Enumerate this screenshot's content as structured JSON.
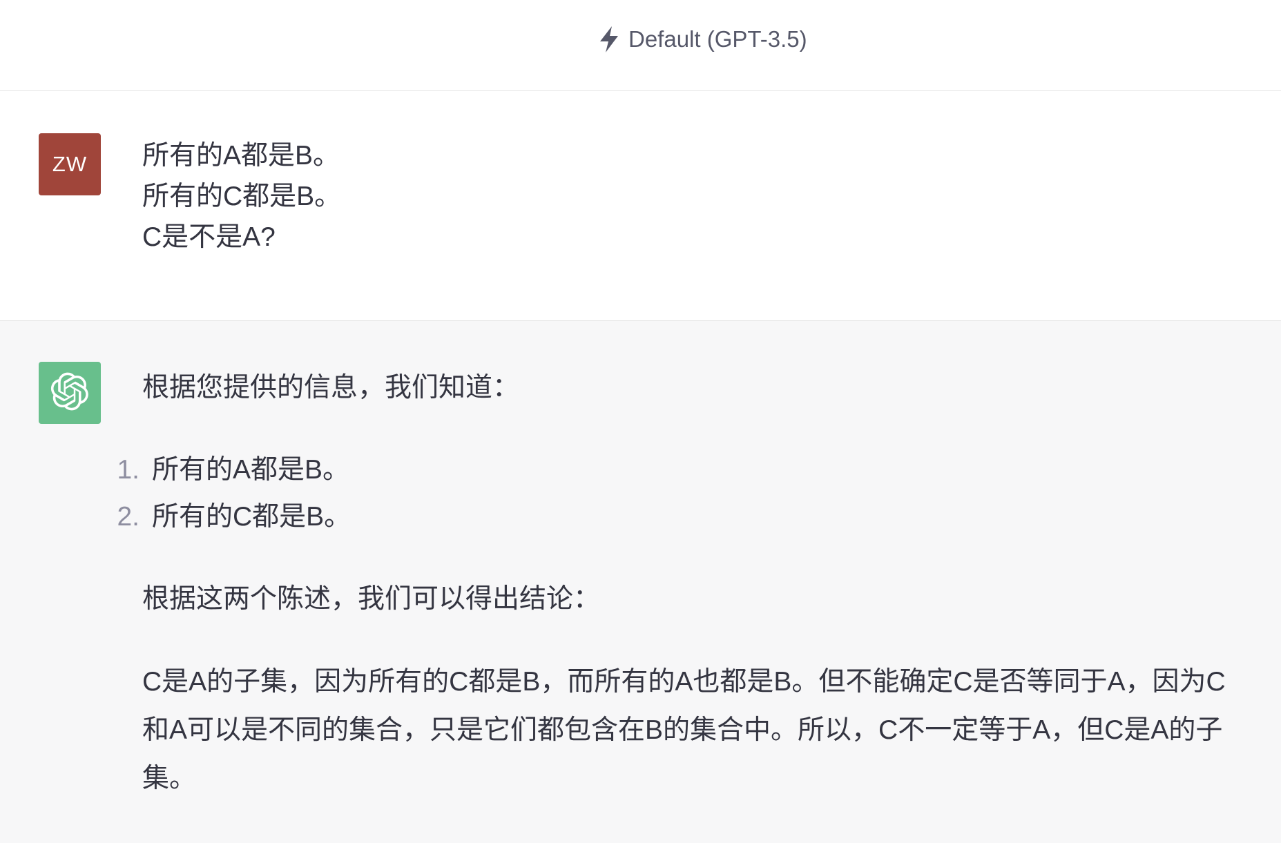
{
  "header": {
    "model_label": "Default (GPT-3.5)",
    "icon": "lightning-bolt-icon"
  },
  "user_message": {
    "avatar_initials": "ZW",
    "lines": [
      "所有的A都是B。",
      "所有的C都是B。",
      "C是不是A?"
    ]
  },
  "assistant_message": {
    "avatar_icon": "openai-logo-icon",
    "intro": "根据您提供的信息，我们知道：",
    "list": [
      {
        "number": "1.",
        "text": "所有的A都是B。"
      },
      {
        "number": "2.",
        "text": "所有的C都是B。"
      }
    ],
    "conclusion_intro": "根据这两个陈述，我们可以得出结论：",
    "conclusion": "C是A的子集，因为所有的C都是B，而所有的A也都是B。但不能确定C是否等同于A，因为C和A可以是不同的集合，只是它们都包含在B的集合中。所以，C不一定等于A，但C是A的子集。"
  },
  "colors": {
    "text": "#343541",
    "header_text": "#565869",
    "list_number": "#8e8ea0",
    "user_avatar": "#a0453a",
    "assistant_avatar": "#68bf8c",
    "assistant_background": "#f7f7f8",
    "divider": "#e5e5e5"
  }
}
